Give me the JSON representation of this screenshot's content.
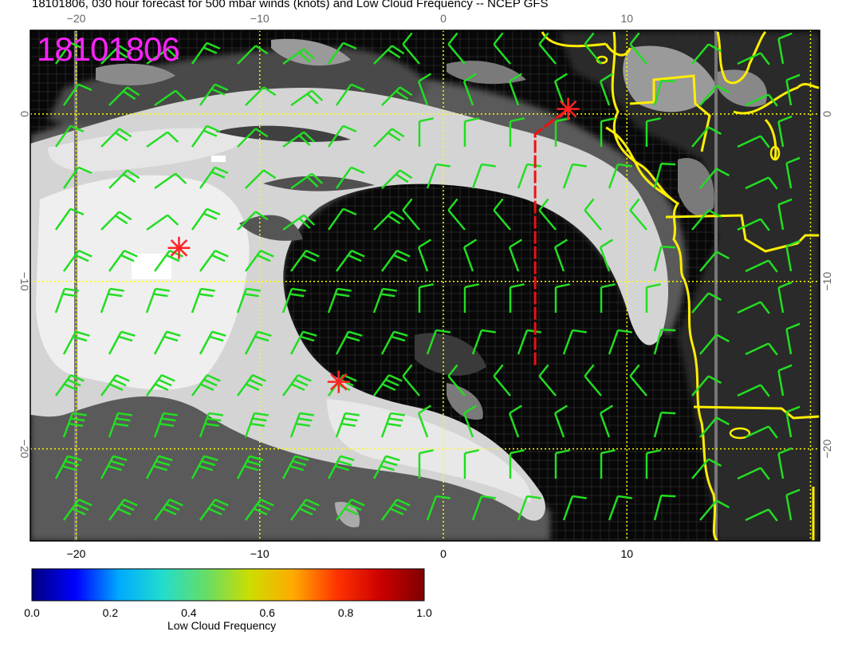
{
  "title": "18101806, 030 hour forecast for 500 mbar winds (knots) and Low Cloud Frequency -- NCEP GFS",
  "stamp": "18101806",
  "map": {
    "lon_range": [
      -22.5,
      20.5
    ],
    "lat_range": [
      -25.5,
      5
    ],
    "lon_ticks": [
      -20,
      -10,
      0,
      10
    ],
    "lat_ticks": [
      0,
      -10,
      -20
    ],
    "lon_tick_labels": [
      "−20",
      "−10",
      "0",
      "10"
    ],
    "lat_tick_labels": [
      "0",
      "−10",
      "−20"
    ],
    "grid_color": "#ffff00",
    "coast_color": "#ffff00",
    "barb_color": "#22dd22",
    "marker_color": "#ff2222",
    "track_color": "#ee1111"
  },
  "markers": [
    {
      "name": "star-1",
      "lon": -14.4,
      "lat": -8.0
    },
    {
      "name": "star-2",
      "lon": -5.7,
      "lat": -16.0
    },
    {
      "name": "star-3",
      "lon": 6.8,
      "lat": 0.3
    }
  ],
  "track": [
    [
      5.0,
      -15.0
    ],
    [
      5.0,
      -1.2
    ],
    [
      6.8,
      0.3
    ]
  ],
  "colorbar": {
    "label": "Low Cloud Frequency",
    "tick_values": [
      0.0,
      0.2,
      0.4,
      0.6,
      0.8,
      1.0
    ],
    "tick_labels": [
      "0.0",
      "0.2",
      "0.4",
      "0.6",
      "0.8",
      "1.0"
    ],
    "colors": [
      "#00007f",
      "#0000ff",
      "#00aaff",
      "#22ddcc",
      "#66dd66",
      "#ccdd00",
      "#ffaa00",
      "#ff3300",
      "#cc0000",
      "#7f0000"
    ]
  }
}
